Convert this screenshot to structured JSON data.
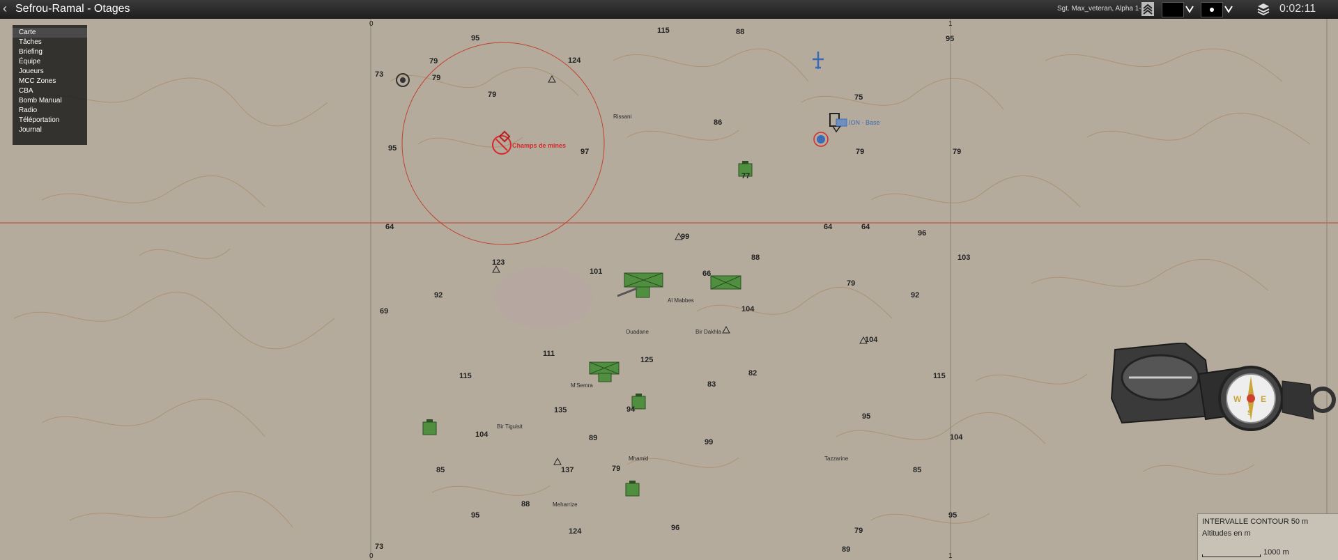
{
  "header": {
    "title": "Sefrou-Ramal - Otages",
    "player": "Sgt. Max_veteran, Alpha 1-4 1",
    "time": "0:02:11",
    "rank_icon": "sergeant-chevrons-icon",
    "layers_icon": "layers-icon"
  },
  "menu": {
    "items": [
      "Carte",
      "Tâches",
      "Briefing",
      "Équipe",
      "Joueurs",
      "MCC Zones",
      "CBA",
      "Bomb Manual",
      "Radio",
      "Téléportation",
      "Journal"
    ]
  },
  "map": {
    "grid_labels": {
      "top_left": "0",
      "top_right": "1",
      "bottom_left": "0",
      "bottom_right": "1"
    },
    "marker_minefield": "Champs de mines",
    "marker_base": "ION - Base",
    "towns": [
      "Rissani",
      "Al Mabbes",
      "Ouadane",
      "Bir Dakhla",
      "M'Semra",
      "Bir Tiguisit",
      "Mhamid",
      "Meharrize",
      "Tazzarine"
    ],
    "altitudes": [
      "95",
      "115",
      "88",
      "95",
      "79",
      "124",
      "73",
      "79",
      "79",
      "75",
      "86",
      "95",
      "97",
      "79",
      "79",
      "77",
      "64",
      "99",
      "64",
      "64",
      "96",
      "123",
      "88",
      "103",
      "101",
      "66",
      "92",
      "79",
      "92",
      "69",
      "104",
      "104",
      "111",
      "125",
      "115",
      "82",
      "115",
      "83",
      "94",
      "135",
      "95",
      "104",
      "89",
      "99",
      "104",
      "85",
      "137",
      "79",
      "85",
      "88",
      "95",
      "95",
      "124",
      "96",
      "79",
      "89",
      "73"
    ]
  },
  "legend": {
    "contour": "INTERVALLE CONTOUR 50 m",
    "altitude_unit": "Altitudes en m",
    "scale": "1000 m"
  },
  "colors": {
    "map_background": "#b4ab9d",
    "contour": "#a8875f",
    "grid_line": "#c0422f",
    "enemy": "#d8282a",
    "friendly": "#3b6bb5",
    "neutral_unit": "#4f8f3f"
  }
}
